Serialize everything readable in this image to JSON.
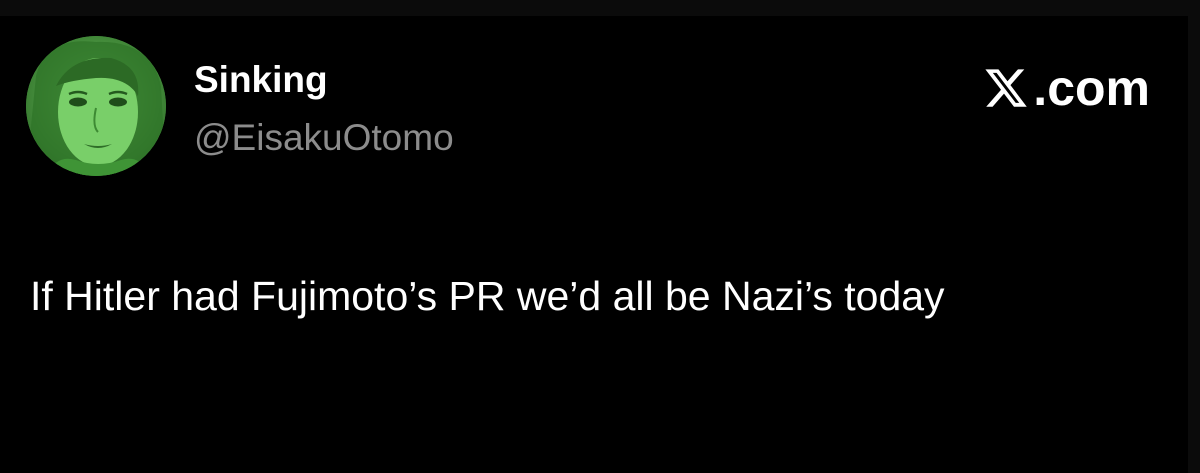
{
  "tweet": {
    "display_name": "Sinking",
    "handle": "@EisakuOtomo",
    "text": "If Hitler had Fujimoto’s PR we’d all be Nazi’s today"
  },
  "brand": {
    "domain_label": ".com",
    "logo_icon": "x-logo-icon"
  },
  "colors": {
    "background": "#000000",
    "text_primary": "#ffffff",
    "text_secondary": "#8c8c8c",
    "avatar_tint": "#4caf3f"
  }
}
